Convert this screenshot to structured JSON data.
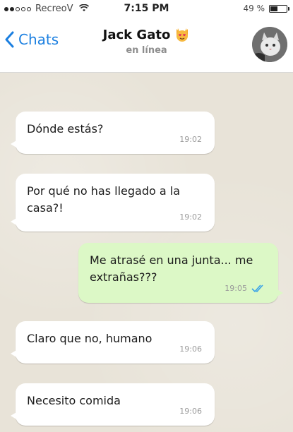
{
  "status_bar": {
    "carrier": "RecreoV",
    "time": "7:15 PM",
    "battery_percent_label": "49 %",
    "battery_level": 0.49,
    "signal_bars_filled": 2,
    "signal_bars_total": 5
  },
  "header": {
    "back_label": "Chats",
    "contact_name": "Jack Gato",
    "contact_status": "en línea",
    "emoji_icon": "heart-eyes-cat-icon"
  },
  "colors": {
    "accent_blue": "#1b7fe0",
    "incoming_bubble": "#ffffff",
    "outgoing_bubble": "#dcf8c6",
    "read_ticks": "#3aa3e8"
  },
  "messages": [
    {
      "direction": "in",
      "text": "Dónde estás?",
      "time": "19:02"
    },
    {
      "direction": "in",
      "text": "Por qué no has llegado a la casa?!",
      "time": "19:02"
    },
    {
      "direction": "out",
      "text": "Me atrasé en una junta... me extrañas???",
      "time": "19:05",
      "status": "read"
    },
    {
      "direction": "in",
      "text": "Claro que no, humano",
      "time": "19:06"
    },
    {
      "direction": "in",
      "text": "Necesito comida",
      "time": "19:06"
    }
  ]
}
